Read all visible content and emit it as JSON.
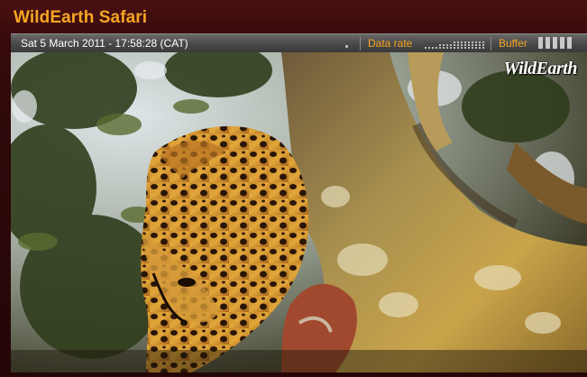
{
  "app": {
    "title": "WildEarth Safari"
  },
  "statusbar": {
    "datetime": "Sat 5 March 2011 - 17:58:28 (CAT)",
    "data_rate_label": "Data rate",
    "buffer_label": "Buffer",
    "buffer_bars": 5
  },
  "video": {
    "watermark": "WildEarth"
  },
  "colors": {
    "accent": "#f5a623",
    "background": "#2a0708",
    "statusbar": "#4a4a4a"
  },
  "icons": [
    "live-indicator-icon",
    "data-rate-meter-icon",
    "buffer-level-icon"
  ]
}
